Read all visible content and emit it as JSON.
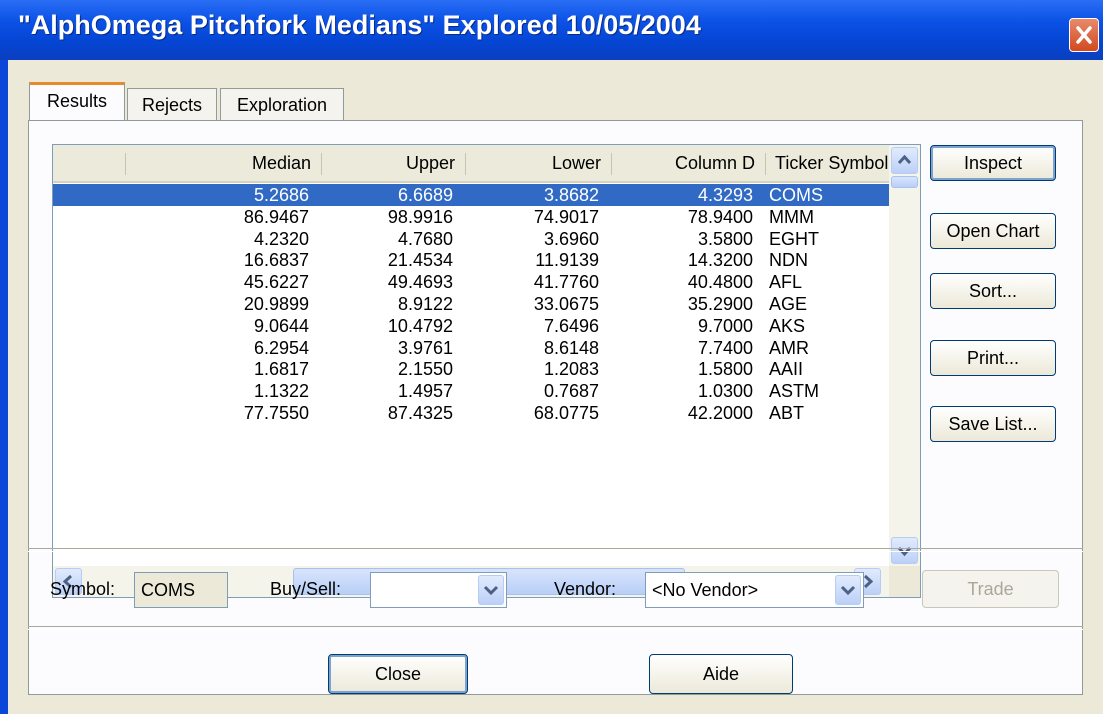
{
  "window": {
    "title": "\"AlphOmega Pitchfork Medians\" Explored 10/05/2004"
  },
  "tabs": [
    {
      "label": "Results",
      "active": true
    },
    {
      "label": "Rejects",
      "active": false
    },
    {
      "label": "Exploration",
      "active": false
    }
  ],
  "table": {
    "columns": [
      "Median",
      "Upper",
      "Lower",
      "Column D",
      "Ticker Symbol"
    ],
    "rows": [
      {
        "median": "5.2686",
        "upper": "6.6689",
        "lower": "3.8682",
        "colD": "4.3293",
        "ticker": "COMS",
        "selected": true
      },
      {
        "median": "86.9467",
        "upper": "98.9916",
        "lower": "74.9017",
        "colD": "78.9400",
        "ticker": "MMM"
      },
      {
        "median": "4.2320",
        "upper": "4.7680",
        "lower": "3.6960",
        "colD": "3.5800",
        "ticker": "EGHT"
      },
      {
        "median": "16.6837",
        "upper": "21.4534",
        "lower": "11.9139",
        "colD": "14.3200",
        "ticker": "NDN"
      },
      {
        "median": "45.6227",
        "upper": "49.4693",
        "lower": "41.7760",
        "colD": "40.4800",
        "ticker": "AFL"
      },
      {
        "median": "20.9899",
        "upper": "8.9122",
        "lower": "33.0675",
        "colD": "35.2900",
        "ticker": "AGE"
      },
      {
        "median": "9.0644",
        "upper": "10.4792",
        "lower": "7.6496",
        "colD": "9.7000",
        "ticker": "AKS"
      },
      {
        "median": "6.2954",
        "upper": "3.9761",
        "lower": "8.6148",
        "colD": "7.7400",
        "ticker": "AMR"
      },
      {
        "median": "1.6817",
        "upper": "2.1550",
        "lower": "1.2083",
        "colD": "1.5800",
        "ticker": "AAII"
      },
      {
        "median": "1.1322",
        "upper": "1.4957",
        "lower": "0.7687",
        "colD": "1.0300",
        "ticker": "ASTM"
      },
      {
        "median": "77.7550",
        "upper": "87.4325",
        "lower": "68.0775",
        "colD": "42.2000",
        "ticker": "ABT"
      }
    ]
  },
  "side_buttons": {
    "inspect": "Inspect",
    "open_chart": "Open Chart",
    "sort": "Sort...",
    "print": "Print...",
    "save_list": "Save List..."
  },
  "bottom": {
    "symbol_label": "Symbol:",
    "symbol_value": "COMS",
    "buysell_label": "Buy/Sell:",
    "buysell_value": "",
    "vendor_label": "Vendor:",
    "vendor_value": "<No Vendor>",
    "trade": "Trade"
  },
  "footer": {
    "close": "Close",
    "aide": "Aide"
  },
  "colors": {
    "titlebar": "#0545d4",
    "selection": "#316ac5",
    "dialog_bg": "#ece9d8",
    "close_button": "#d2491e"
  }
}
